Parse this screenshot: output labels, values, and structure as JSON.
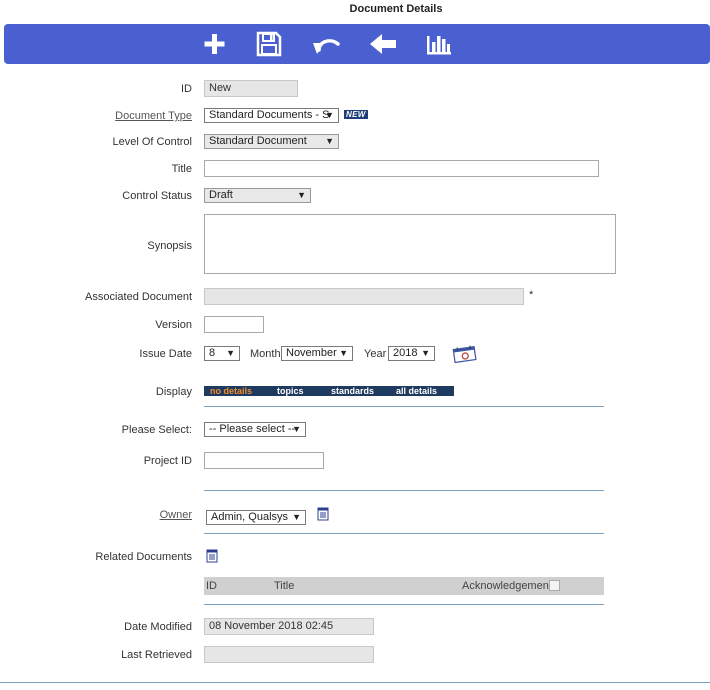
{
  "page": {
    "title": "Document Details"
  },
  "toolbar": {
    "icons": [
      "add-icon",
      "save-icon",
      "undo-icon",
      "back-icon",
      "chart-icon"
    ],
    "color": "#4a5fd0"
  },
  "form": {
    "id": {
      "label": "ID",
      "value": "New"
    },
    "document_type": {
      "label": "Document Type",
      "value": "Standard Documents - S",
      "badge": "NEW"
    },
    "level_of_control": {
      "label": "Level Of Control",
      "value": "Standard Document"
    },
    "title": {
      "label": "Title",
      "value": ""
    },
    "control_status": {
      "label": "Control Status",
      "value": "Draft"
    },
    "synopsis": {
      "label": "Synopsis",
      "value": ""
    },
    "associated_document": {
      "label": "Associated Document",
      "value": "",
      "marker": "*"
    },
    "version": {
      "label": "Version",
      "value": ""
    },
    "issue_date": {
      "label": "Issue Date",
      "day": "8",
      "month_label": "Month",
      "month": "November",
      "year_label": "Year",
      "year": "2018"
    },
    "display": {
      "label": "Display",
      "tabs": [
        "no details",
        "topics",
        "standards",
        "all details"
      ],
      "active": "no details"
    },
    "please_select": {
      "label": "Please Select:",
      "value": "-- Please select --"
    },
    "project_id": {
      "label": "Project ID",
      "value": ""
    },
    "owner": {
      "label": "Owner",
      "value": "Admin, Qualsys"
    },
    "related_documents": {
      "label": "Related Documents",
      "columns": [
        "ID",
        "Title",
        "Acknowledgement"
      ]
    },
    "date_modified": {
      "label": "Date Modified",
      "value": "08 November 2018 02:45"
    },
    "last_retrieved": {
      "label": "Last Retrieved",
      "value": ""
    }
  },
  "colors": {
    "accent": "#4a5fd0",
    "tab_bar": "#1f3a5f",
    "tab_active": "#f28c2f",
    "divider": "#7aa0c0"
  }
}
